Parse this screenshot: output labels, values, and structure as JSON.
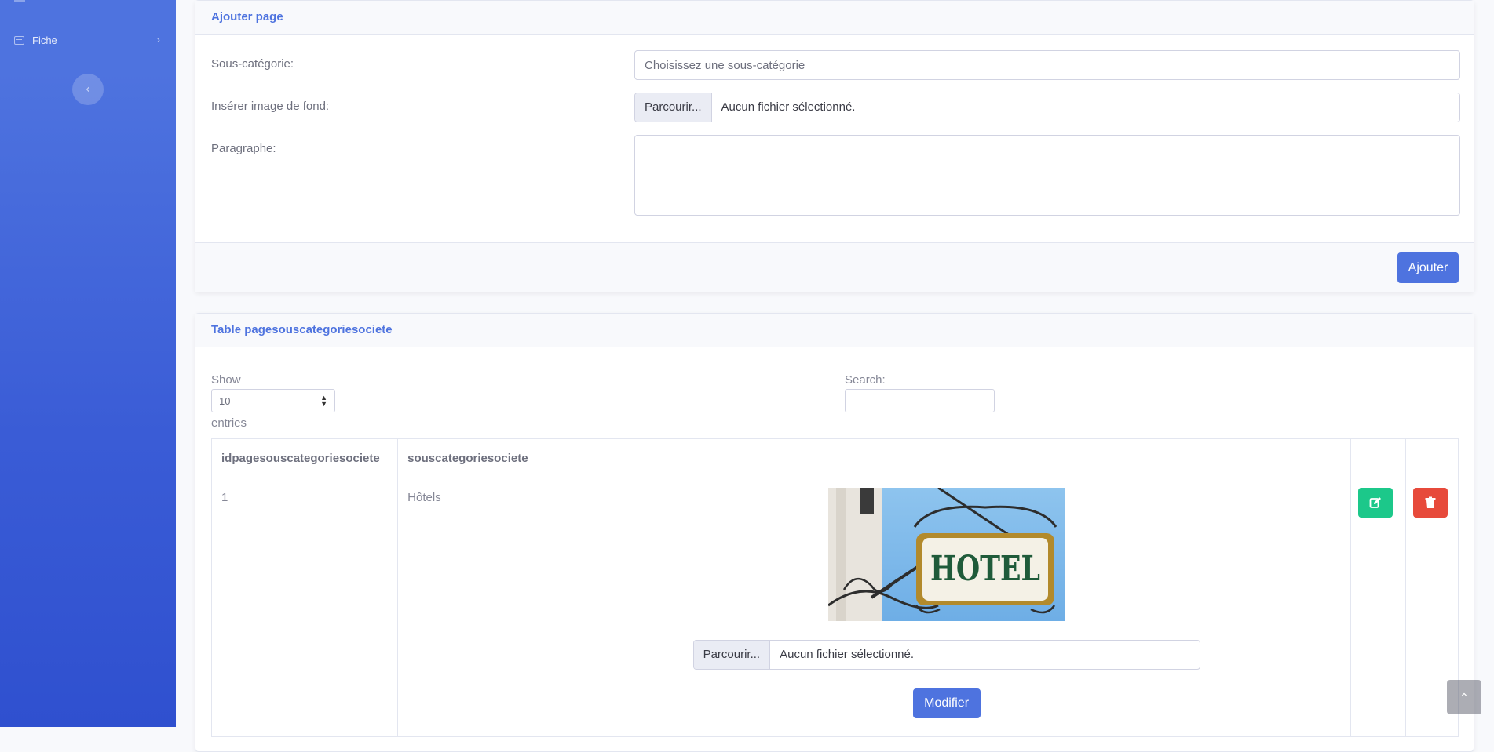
{
  "sidebar": {
    "items": [
      {
        "label": "Fiche",
        "icon": "table-icon"
      }
    ],
    "toggle_icon": "chevron-left-icon"
  },
  "form": {
    "title": "Ajouter page",
    "subcategory_label": "Sous-catégorie:",
    "subcategory_placeholder": "Choisissez une sous-catégorie",
    "image_label": "Insérer image de fond:",
    "file_button": "Parcourir...",
    "file_text": "Aucun fichier sélectionné.",
    "paragraph_label": "Paragraphe:",
    "paragraph_value": "",
    "submit_label": "Ajouter"
  },
  "table_card": {
    "title": "Table pagesouscategoriesociete",
    "show_label": "Show",
    "page_length": "10",
    "entries_label": "entries",
    "search_label": "Search:",
    "search_value": "",
    "columns": [
      "idpagesouscategoriesociete",
      "souscategoriesociete",
      "",
      "",
      ""
    ],
    "rows": [
      {
        "id": "1",
        "souscategorie": "Hôtels",
        "image_sign_text": "HOTEL",
        "file_button": "Parcourir...",
        "file_text": "Aucun fichier sélectionné.",
        "modify_label": "Modifier"
      }
    ]
  },
  "colors": {
    "primary": "#4e73df",
    "success": "#1cc88a",
    "danger": "#e74a3b"
  }
}
